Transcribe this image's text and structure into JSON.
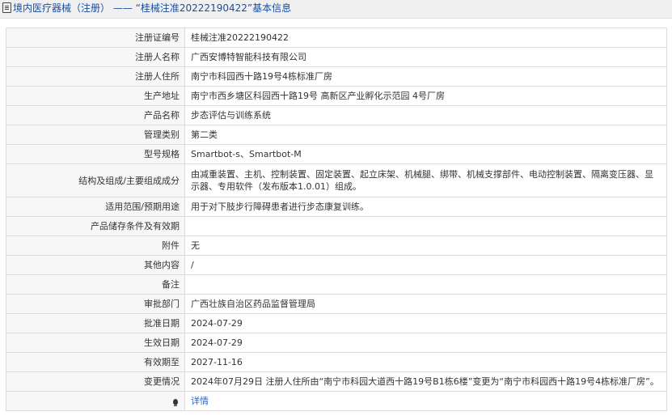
{
  "header": {
    "prefix": "境内医疗器械（注册）",
    "separator": "——",
    "title": "“桂械注准20222190422”基本信息"
  },
  "rows": [
    {
      "label": "注册证编号",
      "value": "桂械注准20222190422"
    },
    {
      "label": "注册人名称",
      "value": "广西安博特智能科技有限公司"
    },
    {
      "label": "注册人住所",
      "value": "南宁市科园西十路19号4栋标准厂房"
    },
    {
      "label": "生产地址",
      "value": "南宁市西乡塘区科园西十路19号 高新区产业孵化示范园 4号厂房"
    },
    {
      "label": "产品名称",
      "value": "步态评估与训练系统"
    },
    {
      "label": "管理类别",
      "value": "第二类"
    },
    {
      "label": "型号规格",
      "value": "Smartbot-s、Smartbot-M"
    },
    {
      "label": "结构及组成/主要组成成分",
      "value": "由减重装置、主机、控制装置、固定装置、起立床架、机械腿、绑带、机械支撑部件、电动控制装置、隔离变压器、显示器、专用软件（发布版本1.0.01）组成。"
    },
    {
      "label": "适用范围/预期用途",
      "value": "用于对下肢步行障碍患者进行步态康复训练。"
    },
    {
      "label": "产品储存条件及有效期",
      "value": ""
    },
    {
      "label": "附件",
      "value": "无"
    },
    {
      "label": "其他内容",
      "value": "/"
    },
    {
      "label": "备注",
      "value": ""
    },
    {
      "label": "审批部门",
      "value": "广西壮族自治区药品监督管理局"
    },
    {
      "label": "批准日期",
      "value": "2024-07-29"
    },
    {
      "label": "生效日期",
      "value": "2024-07-29"
    },
    {
      "label": "有效期至",
      "value": "2027-11-16"
    },
    {
      "label": "变更情况",
      "value": "2024年07月29日 注册人住所由“南宁市科园大道西十路19号B1栋6楼”变更为“南宁市科园西十路19号4栋标准厂房”。"
    }
  ],
  "footer_row": {
    "icon": "bulb-icon",
    "link_label": "详情",
    "link_color": "#2a66c9"
  }
}
